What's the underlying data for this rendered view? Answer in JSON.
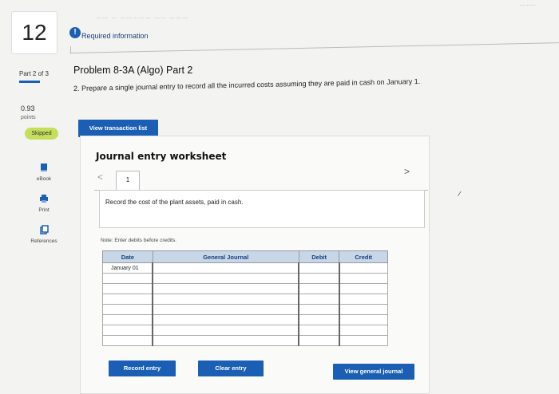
{
  "question_number": "12",
  "header": {
    "info_glyph": "!",
    "required_info": "Required information",
    "faded_top": "…… … …………… …… ………",
    "faded_right": "………"
  },
  "sidebar": {
    "part": "Part 2 of 3",
    "points_value": "0.93",
    "points_label": "points",
    "status": "Skipped",
    "tools": [
      {
        "label": "eBook",
        "icon": "book-icon"
      },
      {
        "label": "Print",
        "icon": "print-icon"
      },
      {
        "label": "References",
        "icon": "references-icon"
      }
    ]
  },
  "problem": {
    "title": "Problem 8-3A (Algo) Part 2",
    "question": "2. Prepare a single journal entry to record all the incurred costs assuming they are paid in cash on January 1.",
    "view_transaction_list": "View transaction list"
  },
  "worksheet": {
    "title": "Journal entry worksheet",
    "prev": "<",
    "next": ">",
    "tab": "1",
    "description": "Record the cost of the plant assets, paid in cash.",
    "note": "Note: Enter debits before credits.",
    "columns": [
      "Date",
      "General Journal",
      "Debit",
      "Credit"
    ],
    "rows": [
      [
        "January 01",
        "",
        "",
        ""
      ],
      [
        "",
        "",
        "",
        ""
      ],
      [
        "",
        "",
        "",
        ""
      ],
      [
        "",
        "",
        "",
        ""
      ],
      [
        "",
        "",
        "",
        ""
      ],
      [
        "",
        "",
        "",
        ""
      ],
      [
        "",
        "",
        "",
        ""
      ],
      [
        "",
        "",
        "",
        ""
      ]
    ],
    "record_entry": "Record entry",
    "clear_entry": "Clear entry",
    "view_general_journal": "View general journal"
  },
  "colors": {
    "accent": "#1a5fb4",
    "skipped": "#c5df5c",
    "table_header": "#c7d7e8"
  }
}
